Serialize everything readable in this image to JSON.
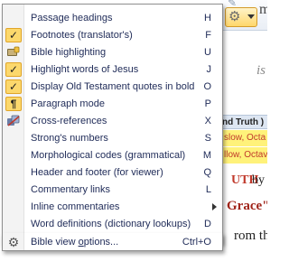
{
  "background": {
    "m_text": "m",
    "is_text": "is",
    "table_head": "nd Truth )",
    "row1": "slow, Octa",
    "row2": "llow, Octav",
    "uth": "UTH",
    "by": "by",
    "grace": "Grace\"",
    "from": "rom the"
  },
  "menu": {
    "items": [
      {
        "label": "Passage headings",
        "accel": "",
        "shortcut": "H",
        "checked": false,
        "icon": "none"
      },
      {
        "label": "Footnotes (translator's)",
        "accel": "",
        "shortcut": "F",
        "checked": true,
        "icon": "check-icon"
      },
      {
        "label": "Bible highlighting",
        "accel": "",
        "shortcut": "U",
        "checked": false,
        "icon": "highlighter-icon"
      },
      {
        "label": "Highlight words of Jesus",
        "accel": "",
        "shortcut": "J",
        "checked": true,
        "icon": "check-icon"
      },
      {
        "label": "Display Old Testament quotes in bold",
        "accel": "",
        "shortcut": "O",
        "checked": true,
        "icon": "check-icon"
      },
      {
        "label": "Paragraph mode",
        "accel": "",
        "shortcut": "P",
        "checked": true,
        "icon": "pilcrow-icon"
      },
      {
        "label": "Cross-references",
        "accel": "",
        "shortcut": "X",
        "checked": false,
        "icon": "cross-reference-icon"
      },
      {
        "label": "Strong's numbers",
        "accel": "",
        "shortcut": "S",
        "checked": false,
        "icon": "none"
      },
      {
        "label": "Morphological codes (grammatical)",
        "accel": "",
        "shortcut": "M",
        "checked": false,
        "icon": "none"
      },
      {
        "label": "Header and footer (for viewer)",
        "accel": "",
        "shortcut": "Q",
        "checked": false,
        "icon": "none"
      },
      {
        "label": "Commentary links",
        "accel": "",
        "shortcut": "L",
        "checked": false,
        "icon": "none"
      },
      {
        "label": "Inline commentaries",
        "accel": "",
        "shortcut": "",
        "checked": false,
        "icon": "none",
        "submenu": true
      },
      {
        "label": "Word definitions (dictionary lookups)",
        "accel": "",
        "shortcut": "D",
        "checked": false,
        "icon": "none"
      }
    ],
    "footer": {
      "label_pre": "Bible view ",
      "label_accel": "o",
      "label_post": "ptions...",
      "shortcut": "Ctrl+O",
      "icon": "gear-icon"
    }
  },
  "colors": {
    "checked_bg": "#fcd86c",
    "menu_text": "#1e2a57",
    "highlight_yellow": "#fff27a",
    "red_letter": "#c0392b"
  }
}
